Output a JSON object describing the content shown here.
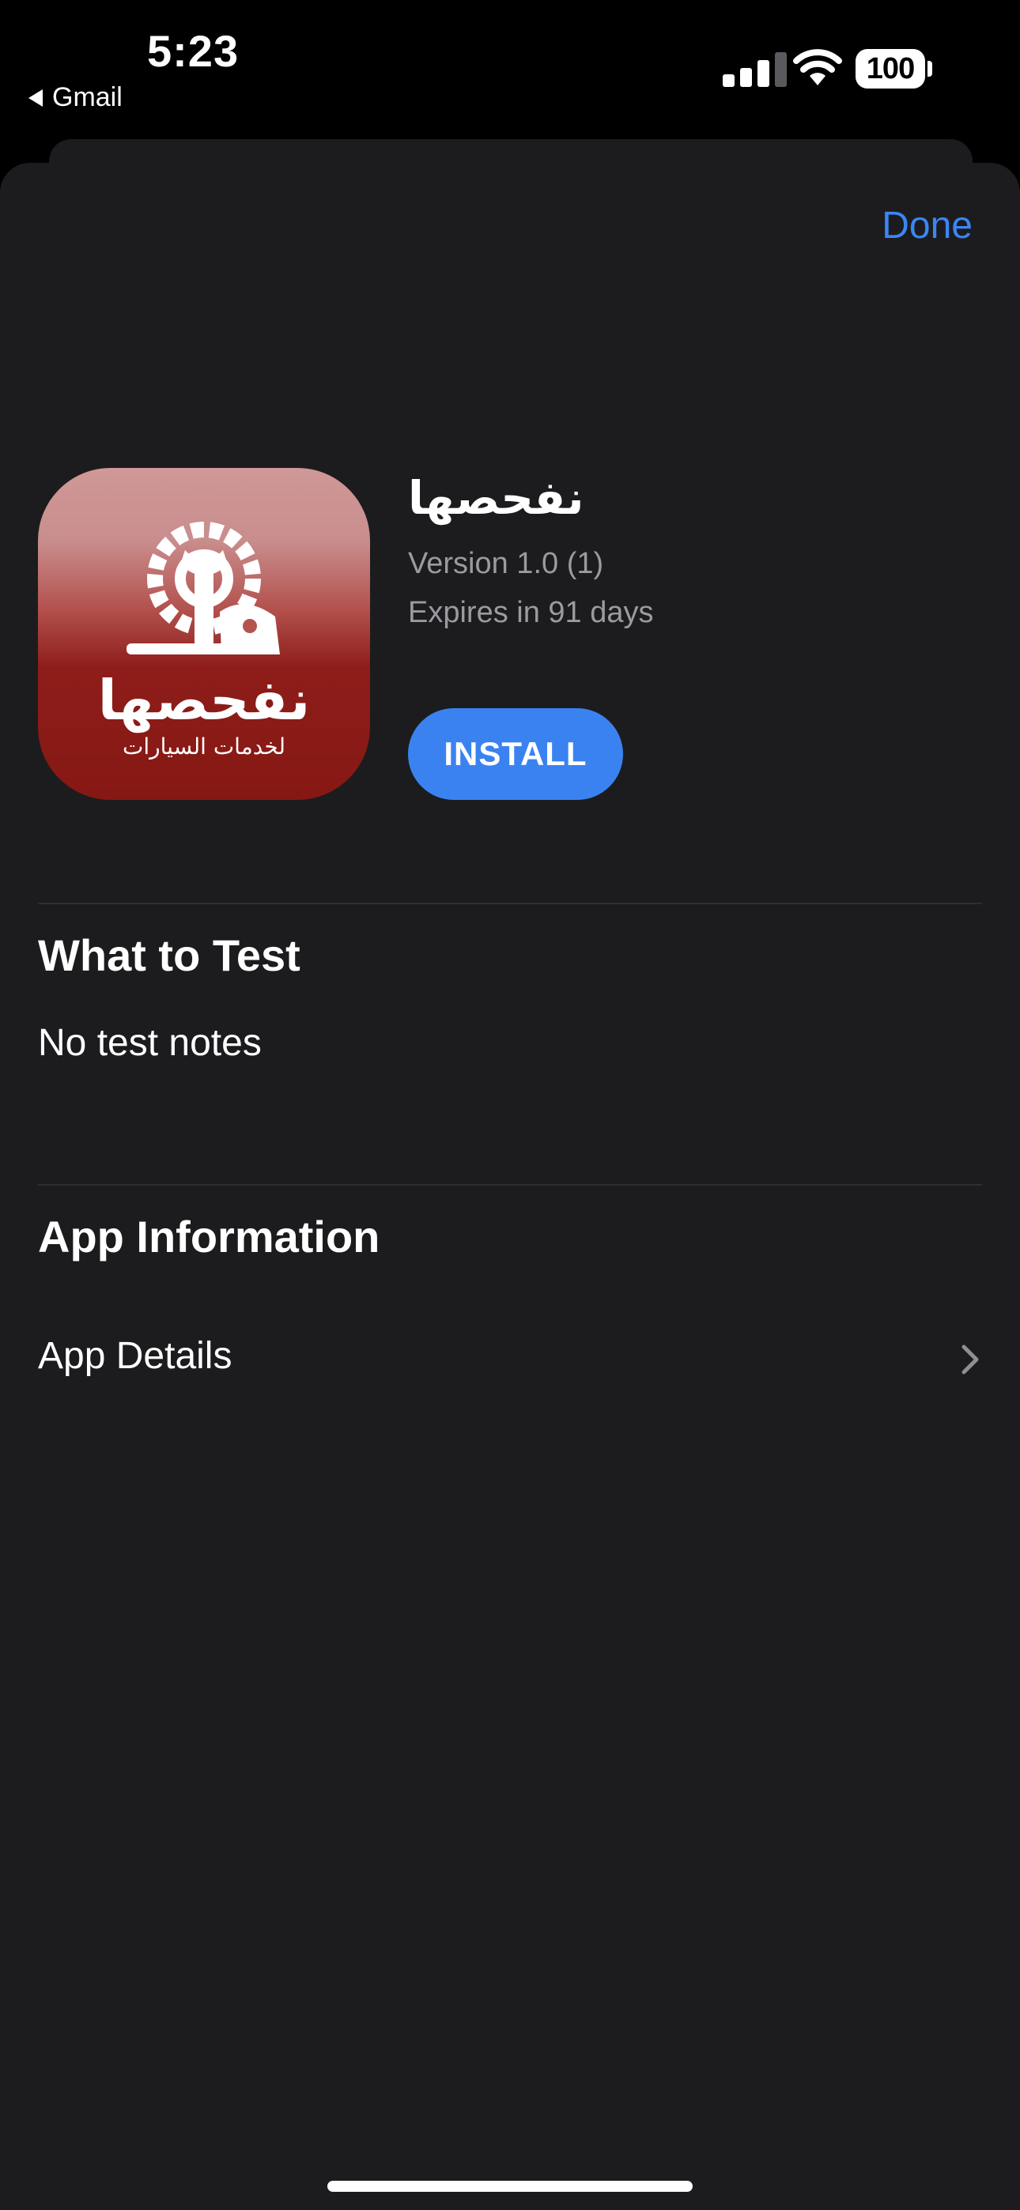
{
  "status_bar": {
    "time": "5:23",
    "back_app": "Gmail",
    "battery": "100"
  },
  "navigation": {
    "done_label": "Done"
  },
  "app": {
    "name": "نفحصها",
    "version": "Version 1.0 (1)",
    "expiry": "Expires in 91 days",
    "install_label": "INSTALL",
    "icon_text": "نفحصها",
    "icon_subtext": "لخدمات السيارات"
  },
  "what_to_test": {
    "title": "What to Test",
    "notes": "No test notes"
  },
  "app_information": {
    "title": "App Information",
    "details_label": "App Details"
  },
  "colors": {
    "accent": "#3a86f5",
    "install_button": "#3b82f1",
    "sheet_background": "#1c1c1e",
    "secondary_text": "#9a9aa0"
  }
}
